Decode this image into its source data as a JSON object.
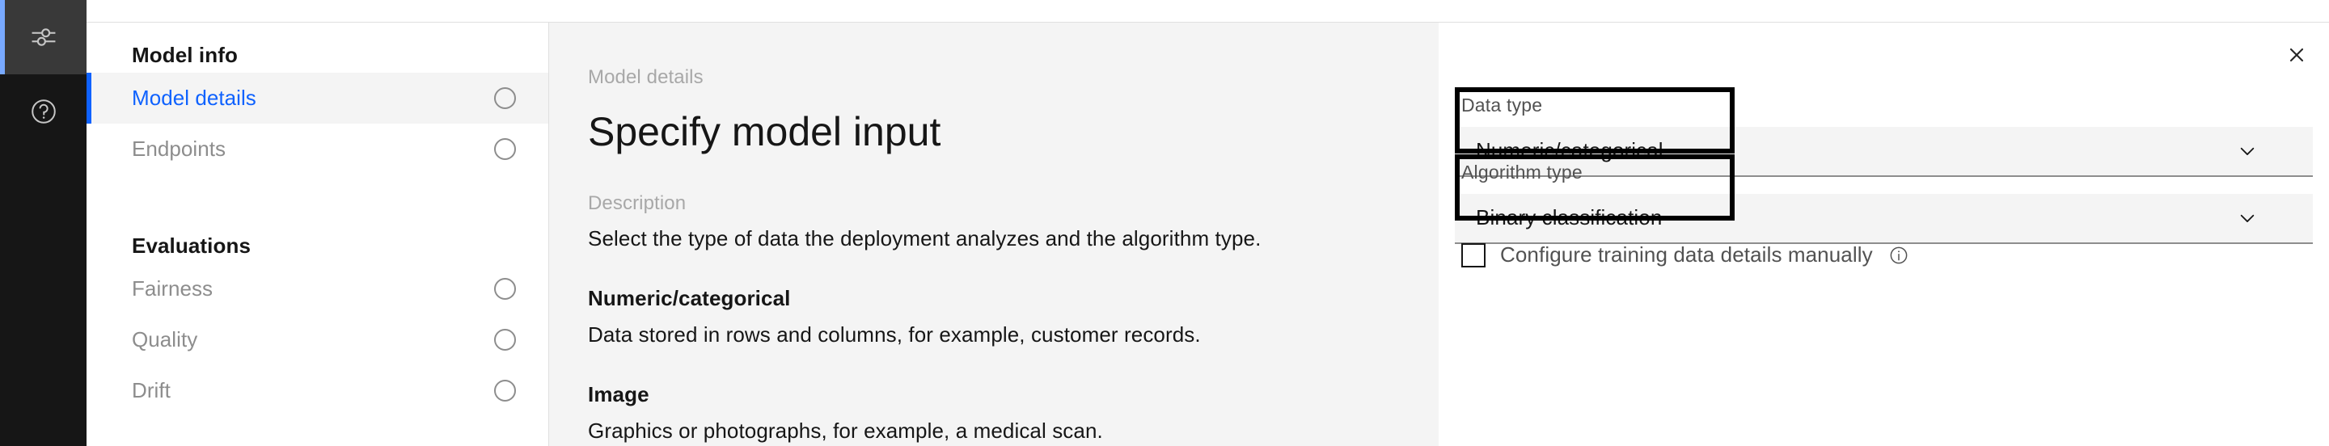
{
  "rail": {
    "items": [
      {
        "name": "settings-sliders",
        "active": true
      },
      {
        "name": "help",
        "active": false
      }
    ]
  },
  "sidebar": {
    "groups": [
      {
        "title": "Model info",
        "items": [
          {
            "label": "Model details",
            "selected": true,
            "has_circle": true
          },
          {
            "label": "Endpoints",
            "selected": false,
            "has_circle": true
          }
        ]
      },
      {
        "title": "Evaluations",
        "items": [
          {
            "label": "Fairness",
            "selected": false,
            "has_circle": true
          },
          {
            "label": "Quality",
            "selected": false,
            "has_circle": true
          },
          {
            "label": "Drift",
            "selected": false,
            "has_circle": true
          }
        ]
      }
    ]
  },
  "main": {
    "eyebrow": "Model details",
    "title": "Specify model input",
    "description_label": "Description",
    "description_text": "Select the type of data the deployment analyzes and the algorithm type.",
    "sections": [
      {
        "heading": "Numeric/categorical",
        "text": "Data stored in rows and columns, for example, customer records."
      },
      {
        "heading": "Image",
        "text": "Graphics or photographs, for example, a medical scan."
      }
    ]
  },
  "form": {
    "close_label": "Close",
    "fields": [
      {
        "label": "Data type",
        "value": "Numeric/categorical",
        "icon": "chevron-down-icon"
      },
      {
        "label": "Algorithm type",
        "value": "Binary classification",
        "icon": "chevron-down-icon"
      }
    ],
    "checkbox": {
      "label": "Configure training data details manually",
      "checked": false,
      "info_icon": "information-icon"
    }
  },
  "colors": {
    "accent_blue": "#0f62fe",
    "rail_active": "#393939",
    "rail_bg": "#161616",
    "rail_accent": "#78a9ff",
    "panel_gray": "#f4f4f4",
    "border_gray": "#e0e0e0",
    "muted_text": "#8d8d8d",
    "annotation": "#000000"
  }
}
